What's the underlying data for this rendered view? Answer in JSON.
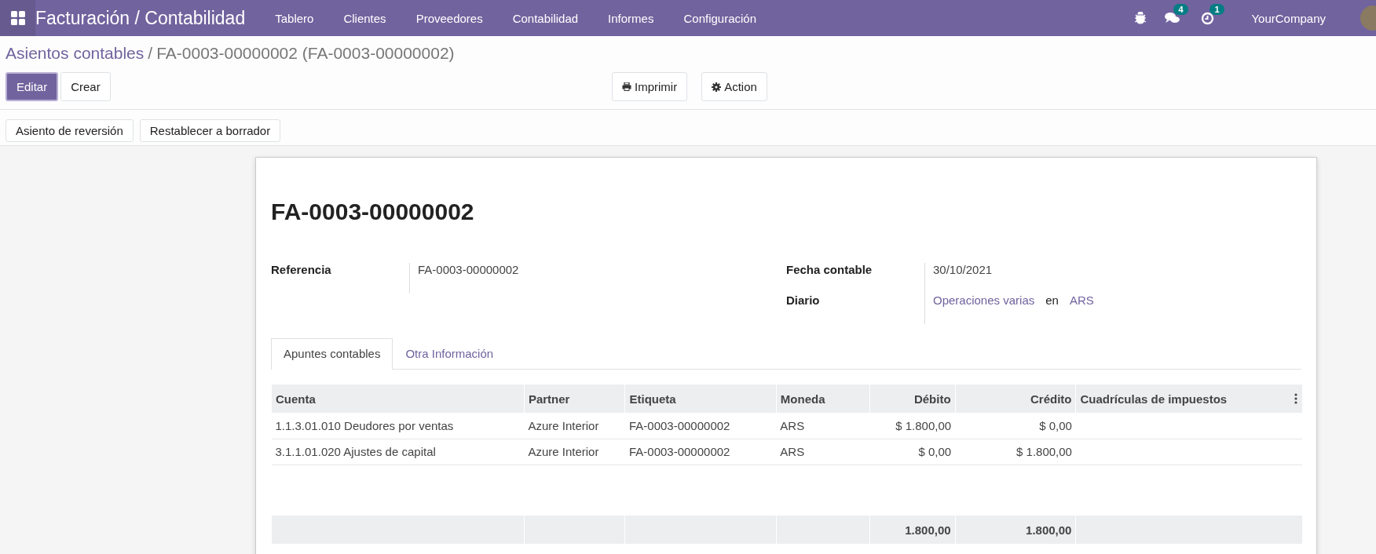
{
  "navbar": {
    "app_title": "Facturación / Contabilidad",
    "menu": [
      "Tablero",
      "Clientes",
      "Proveedores",
      "Contabilidad",
      "Informes",
      "Configuración"
    ],
    "messages_count": "4",
    "activities_count": "1",
    "company": "YourCompany"
  },
  "breadcrumb": {
    "parent": "Asientos contables",
    "separator": "/",
    "current": "FA-0003-00000002 (FA-0003-00000002)"
  },
  "buttons": [
    {
      "label": "Editar",
      "kind": "primary"
    },
    {
      "label": "Crear",
      "kind": "secondary"
    }
  ],
  "toolbar": [
    {
      "label": "Imprimir",
      "kind": "print"
    },
    {
      "label": "Action",
      "kind": "action"
    }
  ],
  "header_buttons": [
    "Asiento de reversión",
    "Restablecer a borrador"
  ],
  "sheet": {
    "title": "FA-0003-00000002",
    "left_fields": [
      {
        "label": "Referencia",
        "value": "FA-0003-00000002"
      }
    ],
    "fecha": {
      "label": "Fecha contable",
      "value": "30/10/2021"
    },
    "diario": {
      "label": "Diario",
      "journal": "Operaciones varias",
      "connector": "en",
      "currency": "ARS"
    },
    "tabs": [
      {
        "label": "Apuntes contables",
        "selected": true
      },
      {
        "label": "Otra Información",
        "selected": false
      }
    ],
    "table": {
      "columns": [
        "Cuenta",
        "Partner",
        "Etiqueta",
        "Moneda",
        "Débito",
        "Crédito",
        "Cuadrículas de impuestos"
      ],
      "rows": [
        [
          "1.1.3.01.010 Deudores por ventas",
          "Azure Interior",
          "FA-0003-00000002",
          "ARS",
          "$ 1.800,00",
          "$ 0,00"
        ],
        [
          "3.1.1.01.020 Ajustes de capital",
          "Azure Interior",
          "FA-0003-00000002",
          "ARS",
          "$ 0,00",
          "$ 1.800,00"
        ]
      ],
      "totals": {
        "debit": "1.800,00",
        "credit": "1.800,00"
      }
    }
  }
}
